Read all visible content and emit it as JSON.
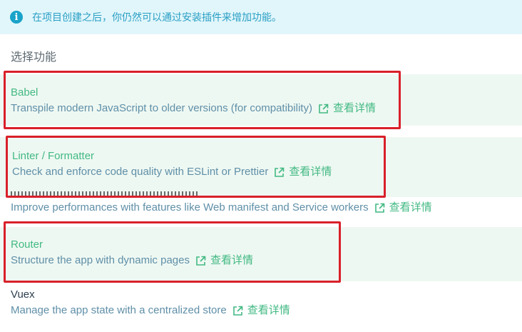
{
  "banner": {
    "text": "在项目创建之后，你仍然可以通过安装插件来增加功能。"
  },
  "section_title": "选择功能",
  "features": [
    {
      "name": "Babel",
      "description": "Transpile modern JavaScript to older versions (for compatibility)",
      "link": "查看详情",
      "selected": true
    },
    {
      "name": "Linter / Formatter",
      "description": "Check and enforce code quality with ESLint or Prettier",
      "link": "查看详情",
      "selected": true
    },
    {
      "name": "",
      "description": "Improve performances with features like Web manifest and Service workers",
      "link": "查看详情",
      "selected": false
    },
    {
      "name": "Router",
      "description": "Structure the app with dynamic pages",
      "link": "查看详情",
      "selected": true
    },
    {
      "name": "Vuex",
      "description": "Manage the app state with a centralized store",
      "link": "查看详情",
      "selected": false
    }
  ],
  "colors": {
    "accent": "#42b983",
    "highlight": "#d9202a",
    "info": "#1aa3c9"
  }
}
